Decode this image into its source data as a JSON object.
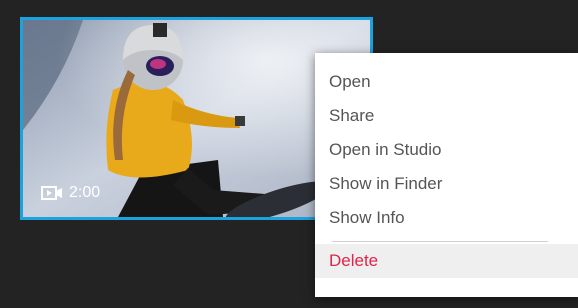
{
  "thumbnail": {
    "duration": "2:00",
    "selected": true,
    "icons": {
      "video": "video-camera-icon"
    },
    "colors": {
      "selection_border": "#1aa3df"
    }
  },
  "context_menu": {
    "items": [
      {
        "label": "Open"
      },
      {
        "label": "Share"
      },
      {
        "label": "Open in Studio"
      },
      {
        "label": "Show in Finder"
      },
      {
        "label": "Show Info"
      }
    ],
    "delete_label": "Delete",
    "colors": {
      "delete": "#e0244a"
    }
  }
}
